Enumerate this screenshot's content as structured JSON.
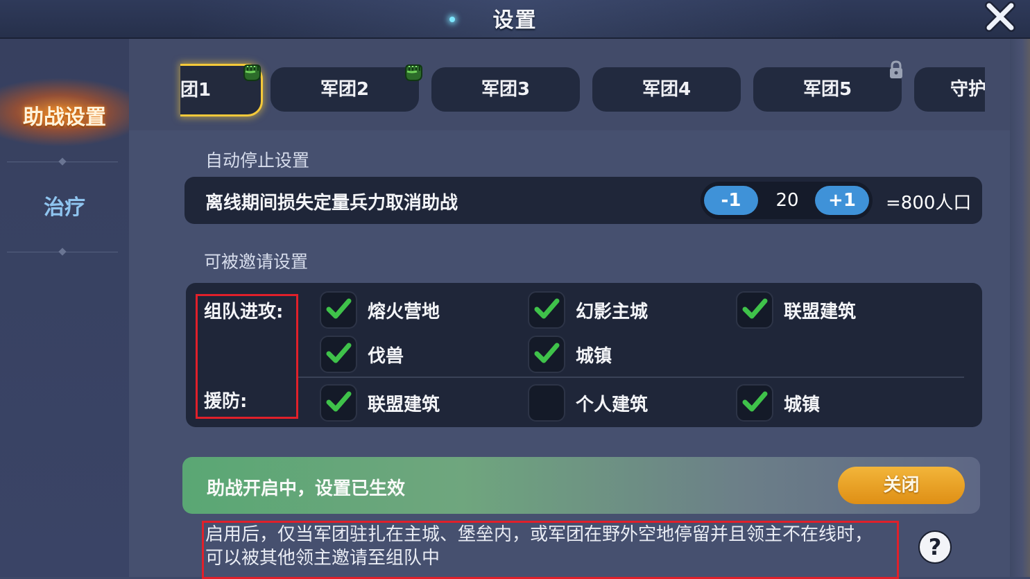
{
  "header": {
    "title": "设置",
    "close_icon": "close-icon"
  },
  "sidebar": {
    "items": [
      {
        "label": "助战设置",
        "active": true
      },
      {
        "label": "治疗",
        "active": false
      }
    ]
  },
  "tabs": [
    {
      "label": "团1",
      "active": true,
      "icon": "fist-icon"
    },
    {
      "label": "军团2",
      "active": false,
      "icon": "fist-icon"
    },
    {
      "label": "军团3",
      "active": false
    },
    {
      "label": "军团4",
      "active": false
    },
    {
      "label": "军团5",
      "active": false,
      "icon": "lock-icon"
    },
    {
      "label": "守护",
      "active": false
    }
  ],
  "auto_stop": {
    "section_title": "自动停止设置",
    "row_label": "离线期间损失定量兵力取消助战",
    "minus_label": "-1",
    "value": "20",
    "plus_label": "+1",
    "total": "=800人口"
  },
  "invite": {
    "section_title": "可被邀请设置",
    "attack_label": "组队进攻:",
    "defense_label": "援防:",
    "attack_options": [
      {
        "label": "熔火营地",
        "checked": true
      },
      {
        "label": "幻影主城",
        "checked": true
      },
      {
        "label": "联盟建筑",
        "checked": true
      },
      {
        "label": "伐兽",
        "checked": true
      },
      {
        "label": "城镇",
        "checked": true
      }
    ],
    "defense_options": [
      {
        "label": "联盟建筑",
        "checked": true
      },
      {
        "label": "个人建筑",
        "checked": false
      },
      {
        "label": "城镇",
        "checked": true
      }
    ]
  },
  "status": {
    "text": "助战开启中，设置已生效",
    "button_label": "关闭"
  },
  "description": {
    "line1": "启用后，仅当军团驻扎在主城、堡垒内，或军团在野外空地停留并且领主不在线时，",
    "line2": "可以被其他领主邀请至组队中"
  },
  "help_icon": "?",
  "colors": {
    "accent_blue": "#3f92d8",
    "check_green": "#3fc24a",
    "active_tab_border": "#f4c93a",
    "close_button": "#e59a1f",
    "highlight_red": "#e0202a"
  }
}
